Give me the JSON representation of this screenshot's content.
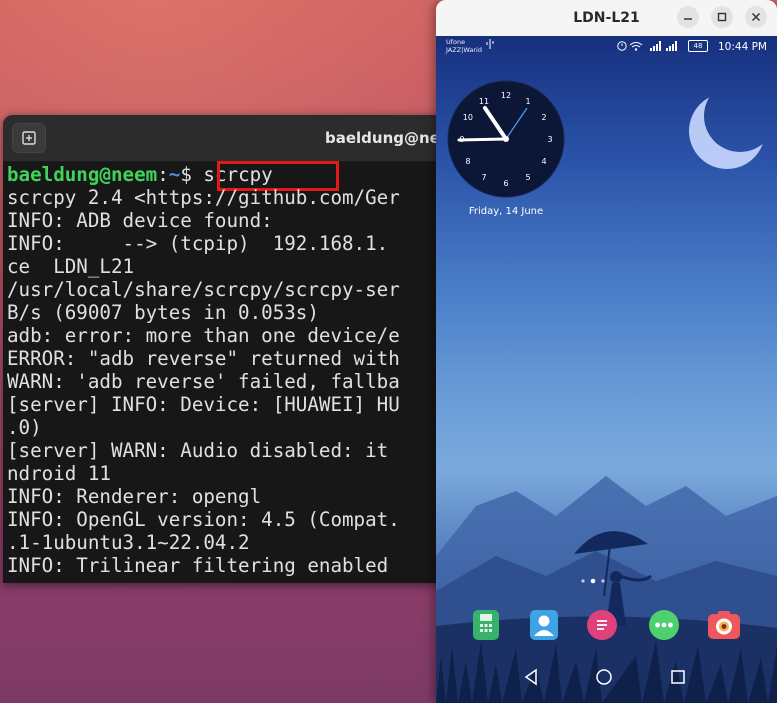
{
  "terminal": {
    "title": "baeldung@neem",
    "prompt_user": "baeldung@neem",
    "prompt_sep": ":",
    "prompt_path": "~",
    "prompt_dollar": "$ ",
    "command": "scrcpy",
    "lines": [
      "scrcpy 2.4 <https://github.com/Ger",
      "INFO: ADB device found:",
      "INFO:     --> (tcpip)  192.168.1.",
      "ce  LDN_L21",
      "/usr/local/share/scrcpy/scrcpy-ser",
      "B/s (69007 bytes in 0.053s)",
      "adb: error: more than one device/e",
      "ERROR: \"adb reverse\" returned with",
      "WARN: 'adb reverse' failed, fallba",
      "[server] INFO: Device: [HUAWEI] HU",
      ".0)",
      "[server] WARN: Audio disabled: it",
      "ndroid 11",
      "INFO: Renderer: opengl",
      "INFO: OpenGL version: 4.5 (Compat.",
      ".1-1ubuntu3.1~22.04.2",
      "INFO: Trilinear filtering enabled"
    ],
    "accent_color": "#e31919"
  },
  "phone": {
    "window_title": "LDN-L21",
    "status": {
      "carrier1": "Ufone",
      "carrier2": "JAZZ|Warid",
      "battery": "48",
      "time": "10:44 PM"
    },
    "clock_numbers": [
      "12",
      "1",
      "2",
      "3",
      "4",
      "5",
      "6",
      "7",
      "8",
      "9",
      "10",
      "11"
    ],
    "date": "Friday, 14 June",
    "dock_apps": [
      "phone-icon",
      "contacts-icon",
      "messaging-icon",
      "apps-icon",
      "camera-icon"
    ]
  }
}
